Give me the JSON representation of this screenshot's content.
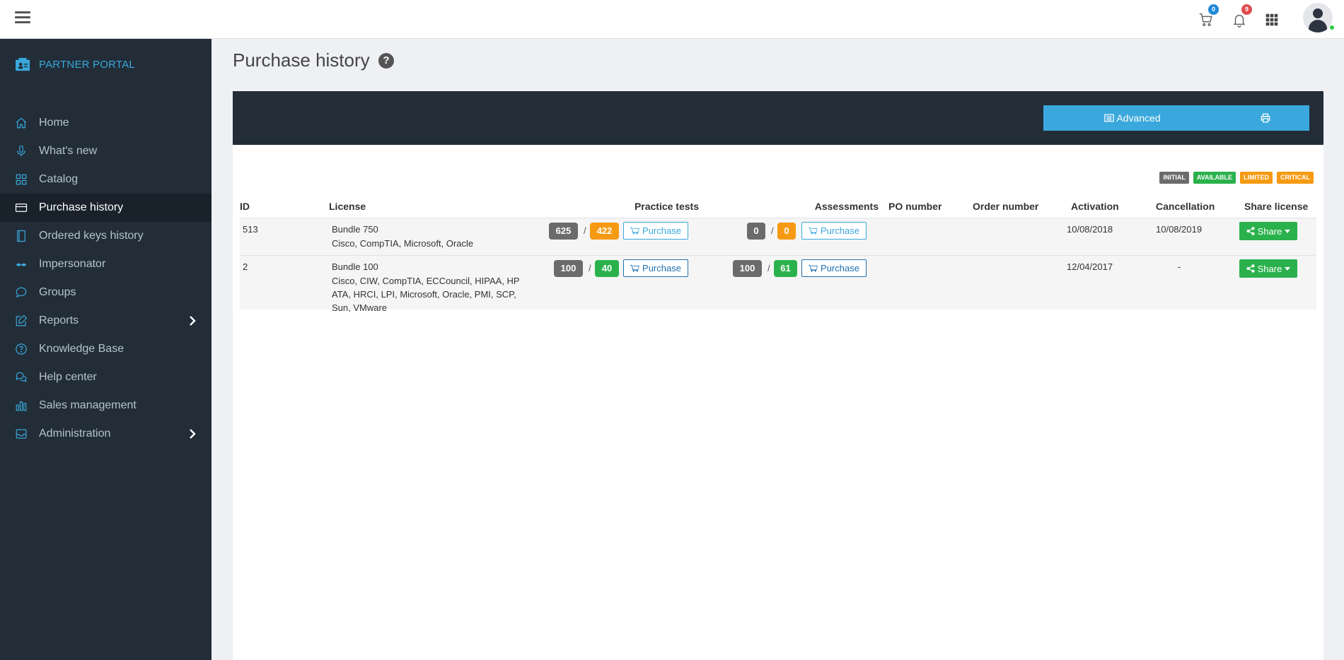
{
  "topbar": {
    "cart_count": "0",
    "notification_count": "9"
  },
  "brand": {
    "name": "PARTNER PORTAL"
  },
  "sidebar": {
    "items": [
      {
        "label": "Home",
        "icon": "home-icon"
      },
      {
        "label": "What's new",
        "icon": "microphone-icon"
      },
      {
        "label": "Catalog",
        "icon": "grid-icon"
      },
      {
        "label": "Purchase history",
        "icon": "credit-card-icon",
        "active": true
      },
      {
        "label": "Ordered keys history",
        "icon": "book-icon"
      },
      {
        "label": "Impersonator",
        "icon": "glasses-icon"
      },
      {
        "label": "Groups",
        "icon": "chat-icon"
      },
      {
        "label": "Reports",
        "icon": "edit-icon",
        "submenu": true
      },
      {
        "label": "Knowledge Base",
        "icon": "question-circle-icon"
      },
      {
        "label": "Help center",
        "icon": "chats-icon"
      },
      {
        "label": "Sales management",
        "icon": "bar-chart-icon"
      },
      {
        "label": "Administration",
        "icon": "inbox-icon",
        "submenu": true
      }
    ]
  },
  "page": {
    "title": "Purchase history",
    "help": "?"
  },
  "toolbar": {
    "advanced_label": "Advanced",
    "print_icon": "print-icon"
  },
  "legend": {
    "initial": "INITIAL",
    "available": "AVAILABLE",
    "limited": "LIMITED",
    "critical": "CRITICAL"
  },
  "colors": {
    "accent": "#3aa8dc",
    "sidebar_bg": "#222d38",
    "initial": "#6b6b6b",
    "available": "#2bb14c",
    "limited": "#f59a12",
    "critical": "#f59a12",
    "cart_badge": "#1e88d8",
    "notification_badge": "#e04b4b"
  },
  "table": {
    "headers": {
      "id": "ID",
      "license": "License",
      "practice": "Practice tests",
      "assessments": "Assessments",
      "po": "PO number",
      "order": "Order number",
      "activation": "Activation",
      "cancellation": "Cancellation",
      "share": "Share license"
    },
    "purchase_label": "Purchase",
    "share_label": "Share",
    "rows": [
      {
        "id": "513",
        "bundle": "Bundle 750",
        "vendors_1": "Cisco, CompTIA, Microsoft, Oracle",
        "vendors_2": "",
        "vendors_3": "",
        "pt_total": "625",
        "pt_left": "422",
        "as_total": "0",
        "as_left": "0",
        "activation": "10/08/2018",
        "cancellation": "10/08/2019"
      },
      {
        "id": "2",
        "bundle": "Bundle 100",
        "vendors_1": "Cisco, CIW, CompTIA, ECCouncil, HIPAA, HP",
        "vendors_2": "ATA, HRCI, LPI, Microsoft, Oracle, PMI, SCP,",
        "vendors_3": "Sun, VMware",
        "pt_total": "100",
        "pt_left": "40",
        "as_total": "100",
        "as_left": "61",
        "activation": "12/04/2017",
        "cancellation": "-"
      }
    ]
  }
}
